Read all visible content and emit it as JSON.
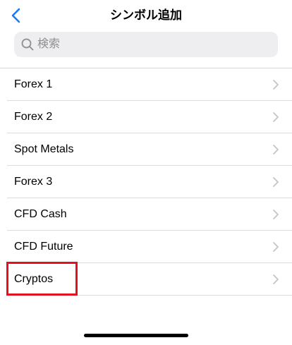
{
  "nav": {
    "title": "シンボル追加",
    "back_icon": "chevron-left-icon",
    "accent_color": "#1a7bf7"
  },
  "search": {
    "placeholder": "検索",
    "value": ""
  },
  "list": {
    "items": [
      {
        "label": "Forex 1"
      },
      {
        "label": "Forex 2"
      },
      {
        "label": "Spot Metals"
      },
      {
        "label": "Forex 3"
      },
      {
        "label": "CFD Cash"
      },
      {
        "label": "CFD Future"
      },
      {
        "label": "Cryptos"
      }
    ]
  },
  "highlight": {
    "target": "Cryptos",
    "color": "#e3101f"
  }
}
